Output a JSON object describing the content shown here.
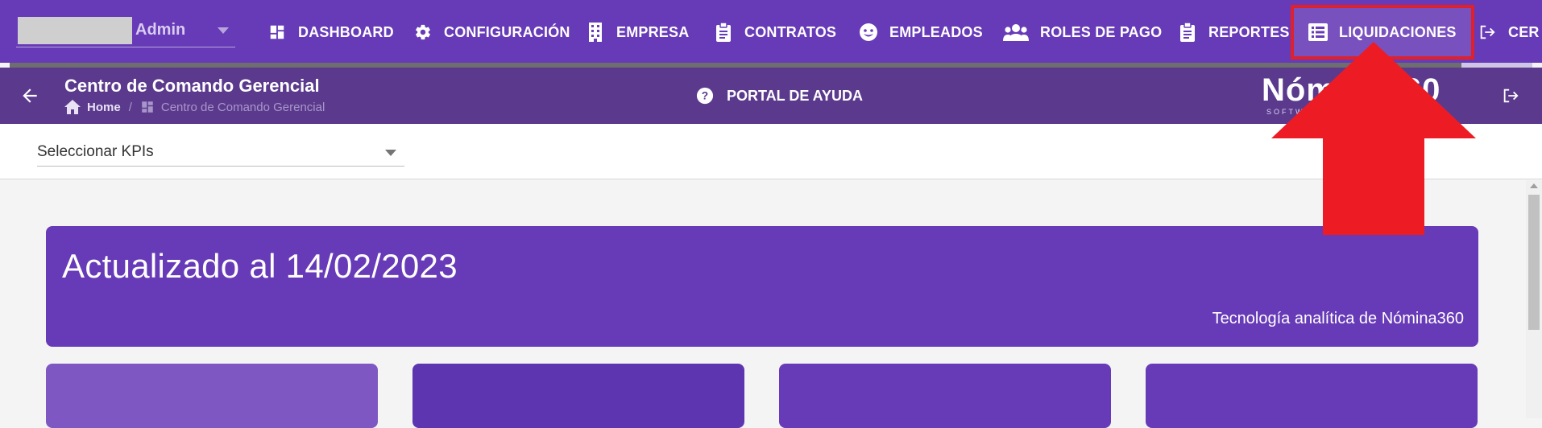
{
  "topnav": {
    "user_label": "Admin",
    "items": [
      {
        "label": "DASHBOARD",
        "icon": "dashboard-icon"
      },
      {
        "label": "CONFIGURACIÓN",
        "icon": "gear-icon"
      },
      {
        "label": "EMPRESA",
        "icon": "building-icon"
      },
      {
        "label": "CONTRATOS",
        "icon": "clipboard-icon"
      },
      {
        "label": "EMPLEADOS",
        "icon": "face-icon"
      },
      {
        "label": "ROLES DE PAGO",
        "icon": "group-icon"
      },
      {
        "label": "REPORTES",
        "icon": "clipboard-icon"
      },
      {
        "label": "LIQUIDACIONES",
        "icon": "list-icon"
      },
      {
        "label": "CER",
        "icon": "logout-icon"
      }
    ],
    "highlighted": "LIQUIDACIONES"
  },
  "header": {
    "title": "Centro de Comando Gerencial",
    "breadcrumb_home": "Home",
    "breadcrumb_sep": "/",
    "breadcrumb_current": "Centro de Comando Gerencial",
    "help_label": "PORTAL DE AYUDA",
    "brand": "Nómina360",
    "brand_sub": "SOFTWARE"
  },
  "kpi": {
    "select_label": "Seleccionar KPIs"
  },
  "banner": {
    "title": "Actualizado al 14/02/2023",
    "subtitle": "Tecnología analítica de Nómina360"
  },
  "colors": {
    "nav_bg": "#673ab7",
    "header_bg": "#5b3a8e",
    "annotation": "#ed1c24"
  }
}
